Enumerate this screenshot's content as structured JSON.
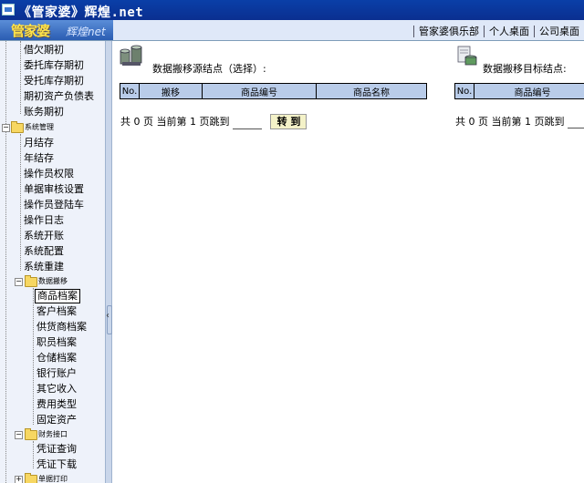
{
  "window": {
    "title": "《管家婆》辉煌.net"
  },
  "header": {
    "logo_brand": "管家婆",
    "logo_sub": "辉煌net",
    "links": [
      "管家婆俱乐部",
      "个人桌面",
      "公司桌面"
    ]
  },
  "sidebar": {
    "top_items": [
      "借欠期初",
      "委托库存期初",
      "受托库存期初",
      "期初资产负债表",
      "账务期初"
    ],
    "groups": [
      {
        "label": "系统管理",
        "expanded": true,
        "items": [
          "月结存",
          "年结存",
          "操作员权限",
          "单据审核设置",
          "操作员登陆车",
          "操作日志",
          "系统开账",
          "系统配置",
          "系统重建"
        ]
      },
      {
        "label": "数据搬移",
        "expanded": true,
        "items": [
          "商品档案",
          "客户档案",
          "供货商档案",
          "职员档案",
          "仓储档案",
          "银行账户",
          "其它收入",
          "费用类型",
          "固定资产"
        ],
        "selected": "商品档案"
      },
      {
        "label": "财务接口",
        "expanded": true,
        "items": [
          "凭证查询",
          "凭证下载"
        ]
      },
      {
        "label": "单据打印",
        "expanded": false,
        "items": []
      }
    ]
  },
  "main": {
    "source": {
      "title": "数据搬移源结点（选择）:",
      "columns": [
        "No.",
        "搬移",
        "商品编号",
        "商品名称"
      ],
      "pager": {
        "prefix": "共 0 页 当前第 1 页跳到",
        "button": "转 到"
      }
    },
    "target": {
      "title": "数据搬移目标结点:",
      "columns": [
        "No.",
        "商品编号"
      ],
      "pager": {
        "prefix": "共 0 页 当前第 1 页跳到"
      }
    }
  },
  "colors": {
    "titlebar": "#0a3fa8",
    "grid_header": "#b9cce9",
    "sidebar_bg": "#eef2fa",
    "logo_text": "#ffe34a"
  }
}
